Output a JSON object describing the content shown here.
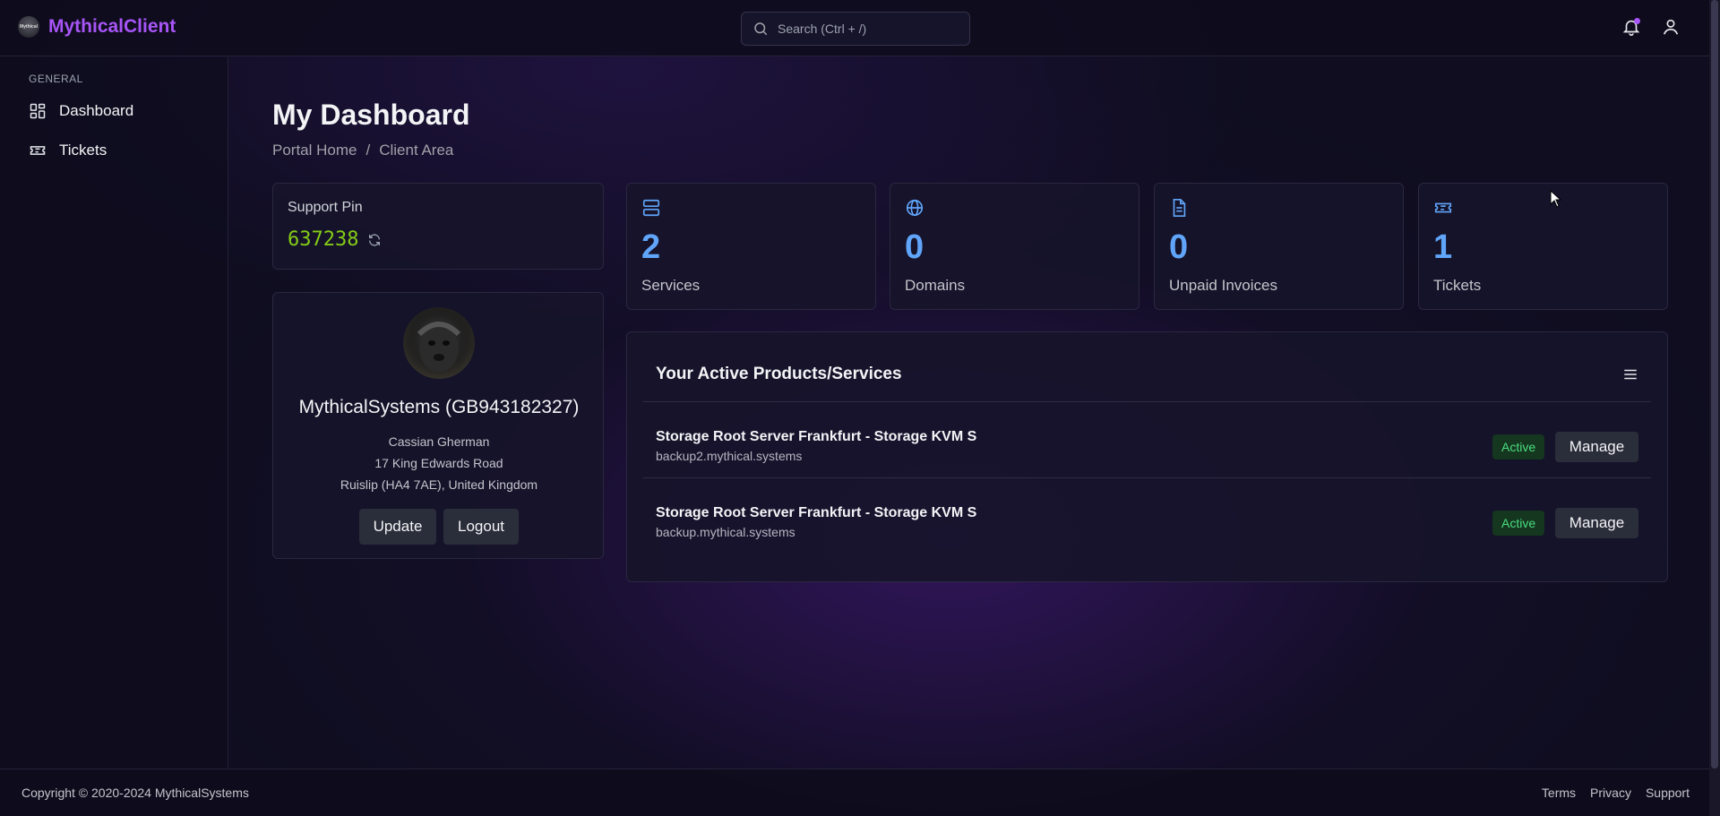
{
  "brand": {
    "name": "MythicalClient",
    "logo_text": "Mythical"
  },
  "search": {
    "placeholder": "Search (Ctrl + /)"
  },
  "sidebar": {
    "section": "GENERAL",
    "items": [
      {
        "label": "Dashboard",
        "icon": "dashboard-icon"
      },
      {
        "label": "Tickets",
        "icon": "ticket-icon"
      }
    ]
  },
  "page": {
    "title": "My Dashboard",
    "breadcrumb": [
      "Portal Home",
      "/",
      "Client Area"
    ]
  },
  "support_pin": {
    "label": "Support Pin",
    "value": "637238"
  },
  "profile": {
    "company": "MythicalSystems (GB943182327)",
    "name": "Cassian Gherman",
    "address_line1": "17 King Edwards Road",
    "address_line2": "Ruislip (HA4 7AE), United Kingdom",
    "update_label": "Update",
    "logout_label": "Logout"
  },
  "stats": [
    {
      "value": "2",
      "label": "Services",
      "icon": "server-icon"
    },
    {
      "value": "0",
      "label": "Domains",
      "icon": "globe-icon"
    },
    {
      "value": "0",
      "label": "Unpaid Invoices",
      "icon": "invoice-icon"
    },
    {
      "value": "1",
      "label": "Tickets",
      "icon": "ticket-icon"
    }
  ],
  "products": {
    "title": "Your Active Products/Services",
    "rows": [
      {
        "name": "Storage Root Server Frankfurt - Storage KVM S",
        "host": "backup2.mythical.systems",
        "status": "Active",
        "action": "Manage"
      },
      {
        "name": "Storage Root Server Frankfurt - Storage KVM S",
        "host": "backup.mythical.systems",
        "status": "Active",
        "action": "Manage"
      }
    ]
  },
  "footer": {
    "copyright": "Copyright © 2020-2024 MythicalSystems",
    "links": [
      "Terms",
      "Privacy",
      "Support"
    ]
  },
  "colors": {
    "accent": "#a855f7",
    "stat": "#60a5fa",
    "pin": "#84cc16",
    "active": "#4ade80"
  }
}
